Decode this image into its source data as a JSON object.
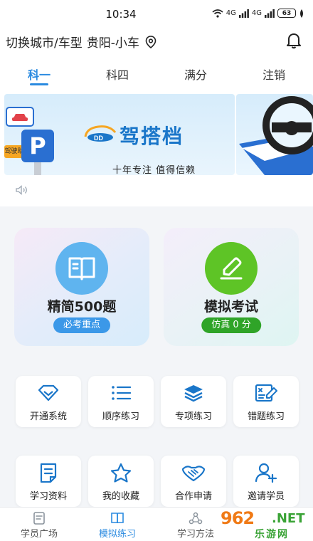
{
  "status_bar": {
    "time": "10:34",
    "signal_1": "4G",
    "signal_2": "4G",
    "battery": "63"
  },
  "header": {
    "city_label": "切换城市/车型",
    "city_value": "贵阳-小车",
    "location_icon": "location-pin-icon",
    "bell_icon": "bell-icon"
  },
  "tabs": [
    {
      "label": "科一",
      "active": true
    },
    {
      "label": "科四",
      "active": false
    },
    {
      "label": "满分",
      "active": false
    },
    {
      "label": "注销",
      "active": false
    }
  ],
  "banner": {
    "brand_title": "驾搭档",
    "brand_slogan": "十年专注 值得信赖",
    "logo_text": "DD",
    "sign_letter": "P",
    "tag_text": "驾驶助",
    "speaker_icon": "speaker-icon"
  },
  "big_cards": [
    {
      "title": "精简500题",
      "badge": "必考重点",
      "icon": "book-icon",
      "color": "#5fb4ef"
    },
    {
      "title": "模拟考试",
      "badge": "仿真 0 分",
      "icon": "pencil-icon",
      "color": "#5ec426"
    }
  ],
  "grid_row_1": [
    {
      "label": "开通系统",
      "icon": "diamond-icon"
    },
    {
      "label": "顺序练习",
      "icon": "list-icon"
    },
    {
      "label": "专项练习",
      "icon": "layers-icon"
    },
    {
      "label": "错题练习",
      "icon": "wrong-answer-icon"
    }
  ],
  "grid_row_2": [
    {
      "label": "学习资料",
      "icon": "document-icon"
    },
    {
      "label": "我的收藏",
      "icon": "star-icon"
    },
    {
      "label": "合作申请",
      "icon": "handshake-icon"
    },
    {
      "label": "邀请学员",
      "icon": "add-user-icon"
    }
  ],
  "bottom_nav": [
    {
      "label": "学员广场",
      "icon": "square-icon",
      "active": false
    },
    {
      "label": "模拟练习",
      "icon": "book-open-icon",
      "active": true
    },
    {
      "label": "学习方法",
      "icon": "method-icon",
      "active": false
    }
  ],
  "watermark": {
    "number": "962",
    "domain": ".NET",
    "site": "乐游网"
  },
  "colors": {
    "accent": "#2a8ae0",
    "blue_badge": "#3b98e8",
    "green_badge": "#2fa428",
    "icon_blue": "#1a76c9"
  }
}
